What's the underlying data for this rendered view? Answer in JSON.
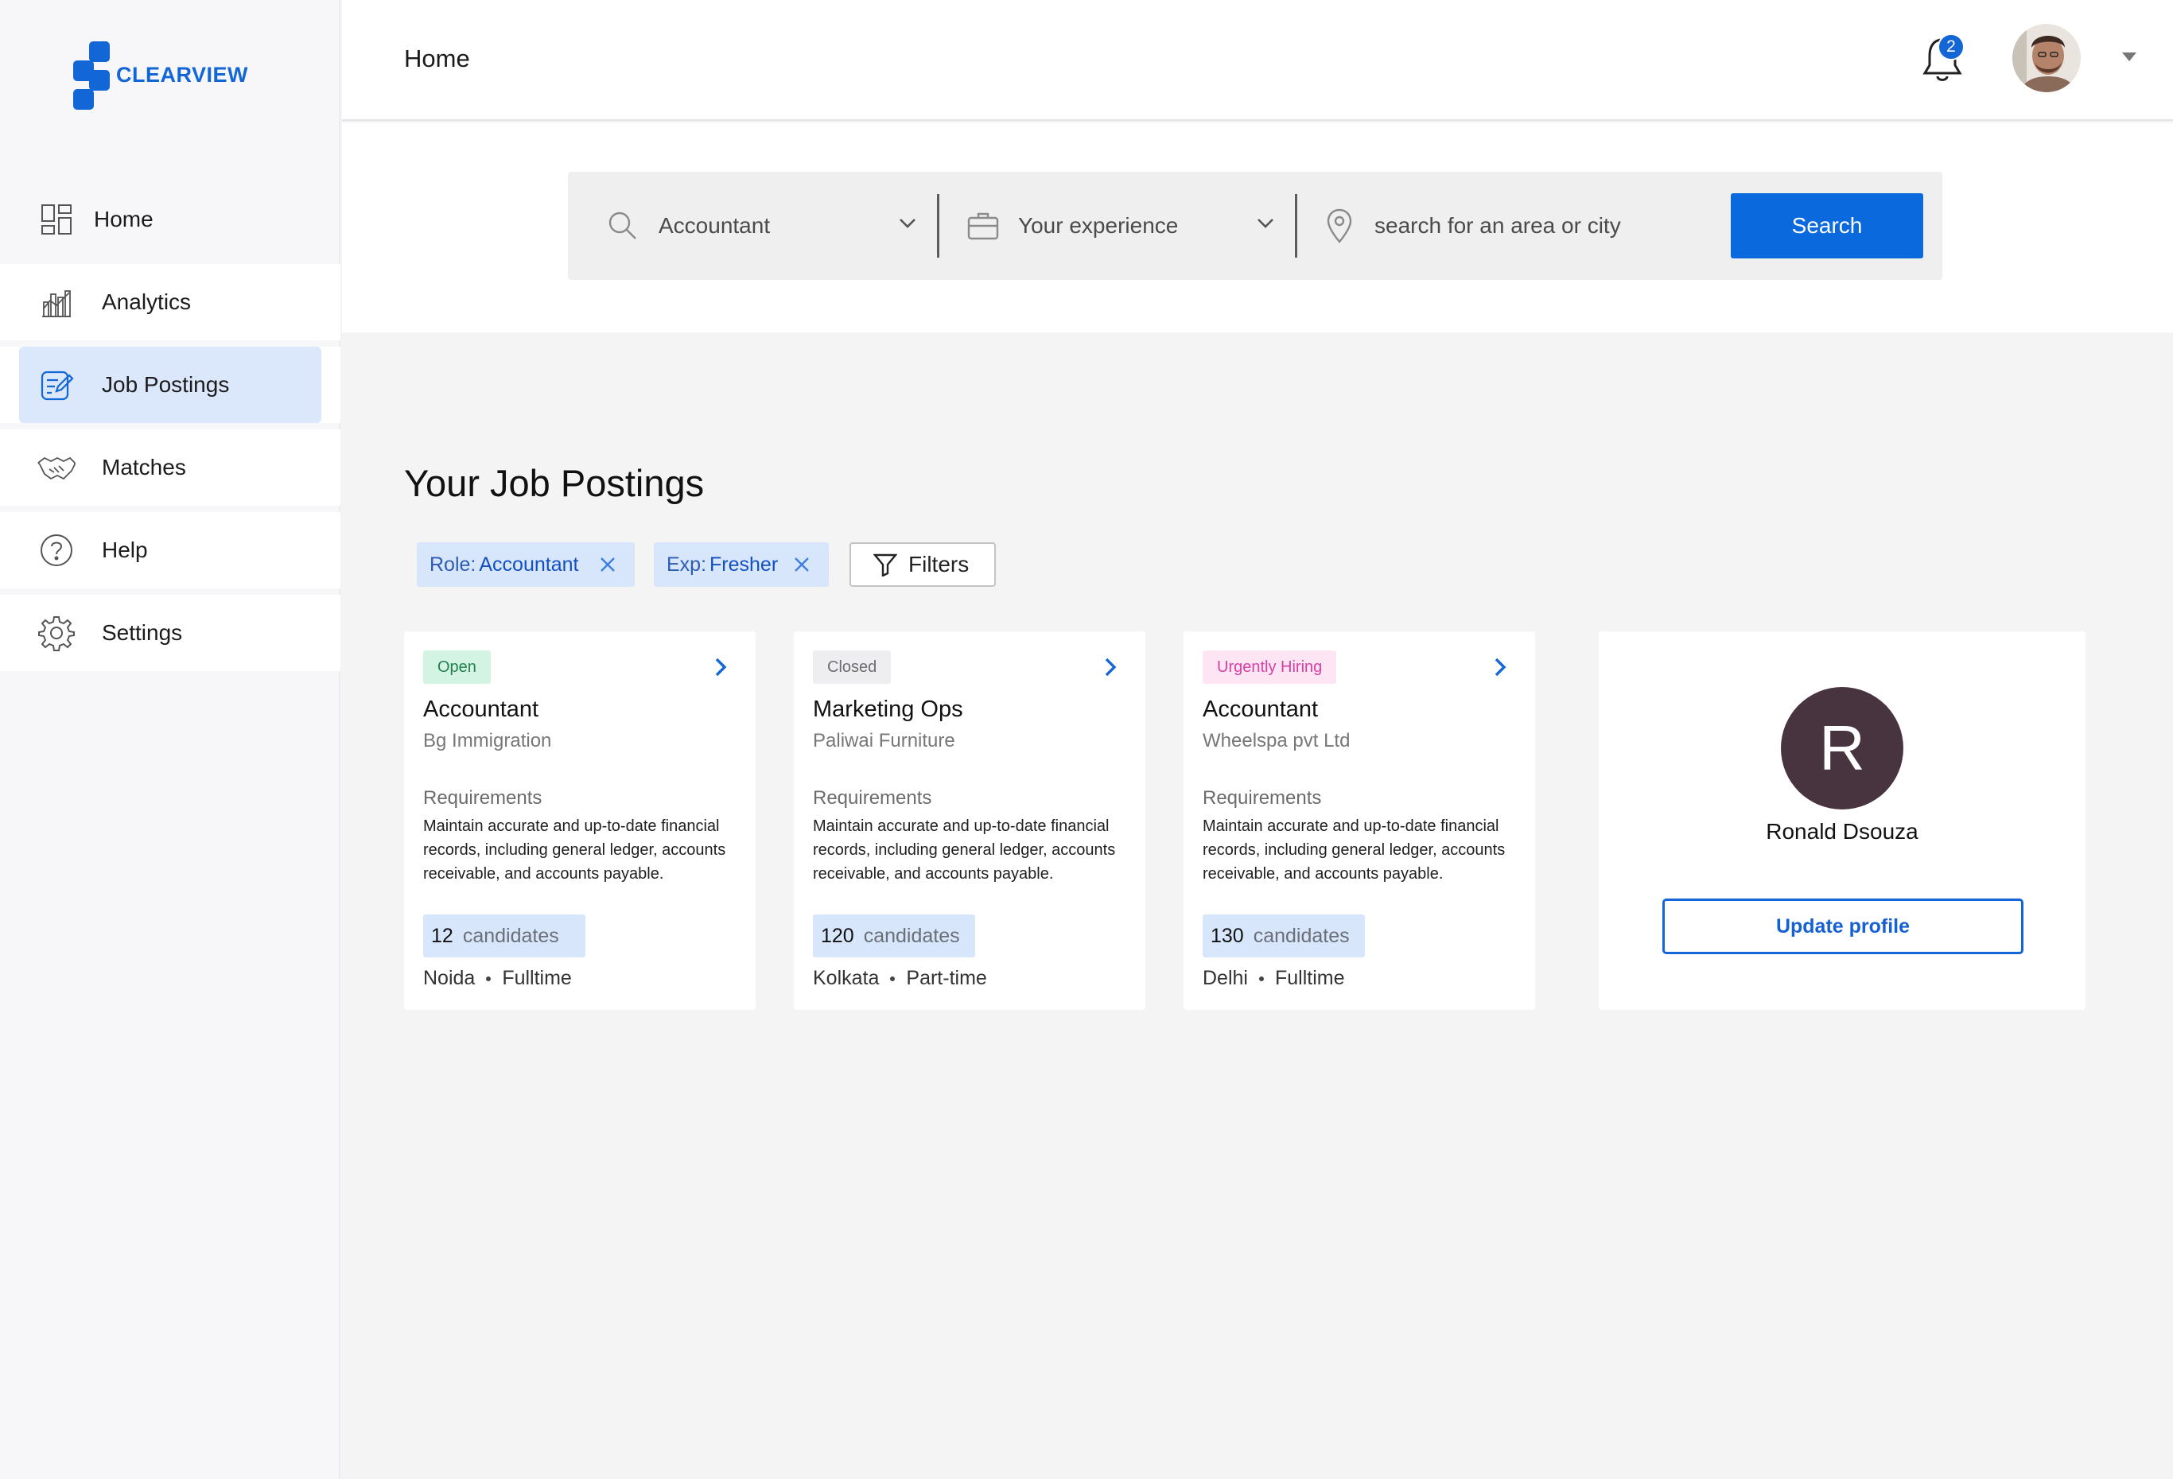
{
  "app": {
    "logo_text": "CLEARVIEW",
    "brand_color": "#1366d6"
  },
  "sidebar": {
    "items": [
      {
        "label": "Home",
        "icon": "dashboard-grid-icon"
      },
      {
        "label": "Analytics",
        "icon": "analytics-chart-icon"
      },
      {
        "label": "Job Postings",
        "icon": "edit-document-icon",
        "active": true
      },
      {
        "label": "Matches",
        "icon": "handshake-icon"
      },
      {
        "label": "Help",
        "icon": "help-circle-icon"
      },
      {
        "label": "Settings",
        "icon": "gear-icon"
      }
    ]
  },
  "header": {
    "title": "Home",
    "notification_count": "2"
  },
  "search": {
    "role_value": "Accountant",
    "experience_placeholder": "Your experience",
    "location_placeholder": "search for an area or city",
    "button_label": "Search"
  },
  "section": {
    "title": "Your Job Postings"
  },
  "filters": {
    "chips": [
      {
        "key": "Role:",
        "value": "Accountant"
      },
      {
        "key": "Exp:",
        "value": "Fresher"
      }
    ],
    "button_label": "Filters"
  },
  "jobs": [
    {
      "status": "Open",
      "status_bg": "#d3f4e2",
      "status_fg": "#22804f",
      "title": "Accountant",
      "company": "Bg Immigration",
      "requirements_label": "Requirements",
      "requirements": "Maintain accurate and up-to-date financial records, including general ledger, accounts receivable, and accounts payable.",
      "candidates_count": "12",
      "candidates_label": "candidates",
      "location": "Noida",
      "type": "Fulltime"
    },
    {
      "status": "Closed",
      "status_bg": "#eeeef0",
      "status_fg": "#6c6c72",
      "title": "Marketing Ops",
      "company": "Paliwai Furniture",
      "requirements_label": "Requirements",
      "requirements": "Maintain accurate and up-to-date financial records, including general ledger, accounts receivable, and accounts payable.",
      "candidates_count": "120",
      "candidates_label": "candidates",
      "location": "Kolkata",
      "type": "Part-time"
    },
    {
      "status": "Urgently Hiring",
      "status_bg": "#fde5f3",
      "status_fg": "#d640a4",
      "title": "Accountant",
      "company": "Wheelspa pvt Ltd",
      "requirements_label": "Requirements",
      "requirements": "Maintain accurate and up-to-date financial records, including general ledger, accounts receivable, and accounts payable.",
      "candidates_count": "130",
      "candidates_label": "candidates",
      "location": "Delhi",
      "type": "Fulltime"
    }
  ],
  "profile": {
    "initial": "R",
    "name": "Ronald Dsouza",
    "button_label": "Update profile",
    "avatar_color": "#47343e"
  }
}
